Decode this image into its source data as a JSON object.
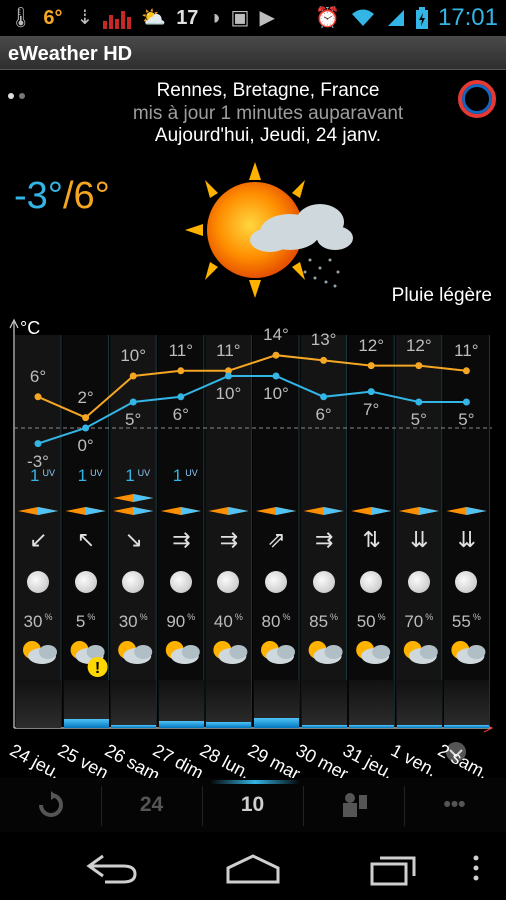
{
  "status_bar": {
    "temp": "6°",
    "temp2": "17",
    "time": "17:01",
    "icons": [
      "temperature-icon",
      "usb-icon",
      "signal-bars-icon",
      "weather-icon",
      "temperature-icon",
      "circle-icon",
      "gallery-icon",
      "play-store-icon",
      "alarm-icon",
      "wifi-icon",
      "cell-signal-icon",
      "battery-icon"
    ]
  },
  "app": {
    "title": "eWeather HD"
  },
  "header": {
    "location": "Rennes, Bretagne, France",
    "updated": "mis à jour 1 minutes auparavant",
    "today": "Aujourd'hui, Jeudi, 24 janv.",
    "temp_low": "-3°",
    "slash": "/",
    "temp_high": "6°",
    "condition": "Pluie légère"
  },
  "chart": {
    "unit": "°C"
  },
  "chart_data": {
    "type": "line",
    "categories": [
      "24 jeu.",
      "25 ven.",
      "26 sam.",
      "27 dim.",
      "28 lun.",
      "29 mar.",
      "30 mer.",
      "31 jeu.",
      "1 ven.",
      "2 sam."
    ],
    "series": [
      {
        "name": "max",
        "values": [
          6,
          2,
          10,
          11,
          11,
          14,
          13,
          12,
          12,
          11
        ]
      },
      {
        "name": "min",
        "values": [
          -3,
          0,
          5,
          6,
          10,
          10,
          6,
          7,
          5,
          5
        ]
      }
    ],
    "hi_labels": [
      "6°",
      "2°",
      "10°",
      "11°",
      "11°",
      "14°",
      "13°",
      "12°",
      "12°",
      "11°"
    ],
    "lo_labels": [
      "-3°",
      "0°",
      "5°",
      "6°",
      "10°",
      "10°",
      "6°",
      "7°",
      "5°",
      "5°"
    ],
    "uv": [
      "1",
      "1",
      "1",
      "1",
      "",
      "",
      "",
      "",
      "",
      ""
    ],
    "uv_unit": "UV",
    "wind_icons": [
      "↙",
      "↖",
      "↘",
      "⇉",
      "⇉",
      "⇗",
      "⇉",
      "⇅",
      "⇊",
      "⇊"
    ],
    "precip_pct": [
      "30",
      "5",
      "30",
      "90",
      "40",
      "80",
      "85",
      "50",
      "70",
      "55"
    ],
    "pct_unit": "%",
    "rain_fill": [
      0,
      0.18,
      0.05,
      0.15,
      0.12,
      0.2,
      0.05,
      0.02,
      0.04,
      0.03
    ],
    "ylim": [
      -4,
      15
    ]
  },
  "bottom_tabs": {
    "refresh_label": "refresh-icon",
    "tab_24": "24",
    "tab_10": "10",
    "map_label": "map-icon",
    "more_label": "•••"
  },
  "colors": {
    "hi": "#f5a623",
    "lo": "#33b5e5",
    "accent": "#33b5e5"
  }
}
